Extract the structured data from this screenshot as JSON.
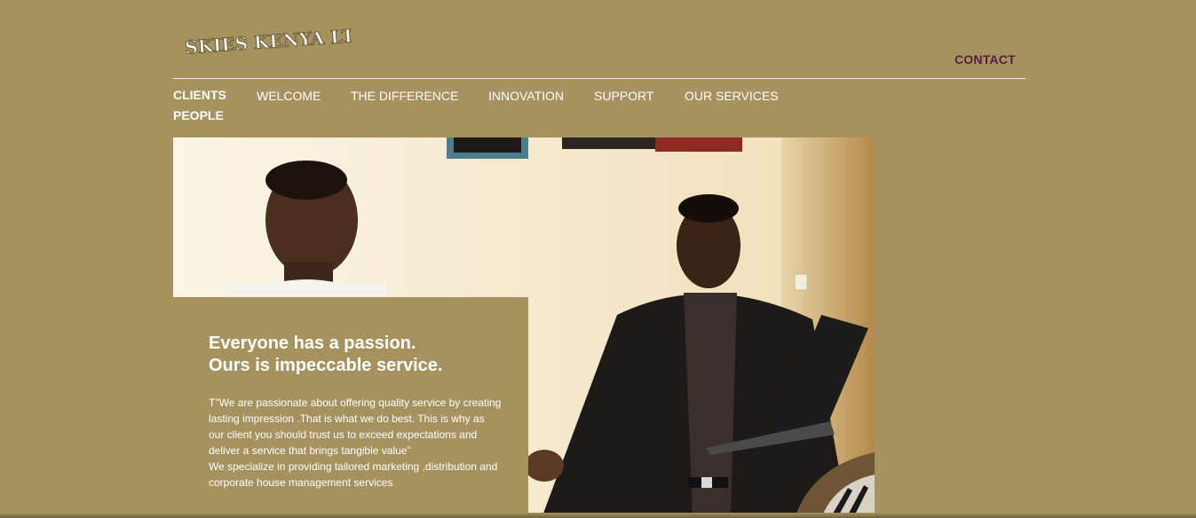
{
  "brand": {
    "logo_text": "SKIES KENYA LTD"
  },
  "header": {
    "contact_label": "CONTACT"
  },
  "nav": {
    "items": [
      {
        "label": "CLIENTS"
      },
      {
        "label": "WELCOME"
      },
      {
        "label": "THE DIFFERENCE"
      },
      {
        "label": "INNOVATION"
      },
      {
        "label": "SUPPORT"
      },
      {
        "label": "OUR SERVICES"
      },
      {
        "label": "PEOPLE"
      }
    ]
  },
  "hero": {
    "headline_line1": "Everyone has a passion.",
    "headline_line2": "Ours is impeccable service.",
    "paragraph1": "T\"We are passionate about offering quality service by creating lasting impression .That is what we do best. This is why as our client you should trust us to exceed expectations and deliver a service that brings tangible value\"",
    "paragraph2": "We specialize in providing tailored marketing ,distribution and corporate house management services"
  },
  "colors": {
    "background": "#a5925e",
    "contact": "#5a1c45",
    "text": "#ffffff"
  }
}
